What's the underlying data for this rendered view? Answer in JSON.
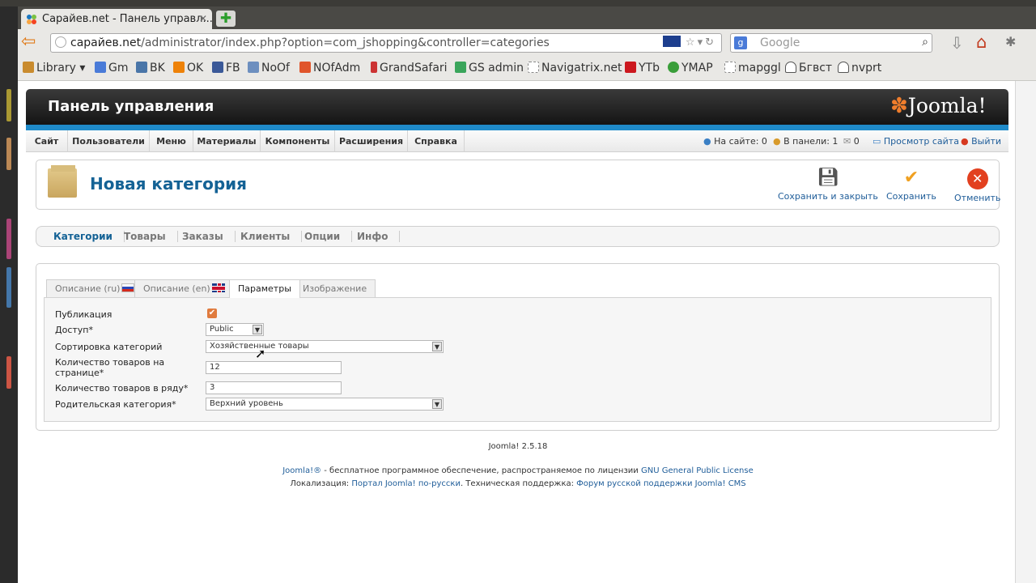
{
  "browser": {
    "tab_title": "Сарайев.net - Панель управл...",
    "url_domain": "сарайев.net",
    "url_path": "/administrator/index.php?option=com_jshopping&controller=categories",
    "search_placeholder": "Google",
    "bookmarks": [
      {
        "label": "Library",
        "color": "#c98b2e"
      },
      {
        "label": "Gm",
        "color": "#4a7bd8"
      },
      {
        "label": "BK",
        "color": "#4a76a8"
      },
      {
        "label": "OK",
        "color": "#ee8208"
      },
      {
        "label": "FB",
        "color": "#3b5998"
      },
      {
        "label": "NoOf",
        "color": "#6d8fbf"
      },
      {
        "label": "NOfAdm",
        "color": "#e0552b"
      },
      {
        "label": "GrandSafari",
        "color": "#cc3333"
      },
      {
        "label": "GS admin",
        "color": "#3aa55b"
      },
      {
        "label": "Navigatrix.net",
        "color": "#dddddd"
      },
      {
        "label": "YTb",
        "color": "#cc181e"
      },
      {
        "label": "YMAP",
        "color": "#3a9e3a"
      },
      {
        "label": "mapggl",
        "color": "#dddddd"
      },
      {
        "label": "Бгвст",
        "color": "#555555"
      },
      {
        "label": "nvprt",
        "color": "#555555"
      }
    ]
  },
  "joomla": {
    "header_title": "Панель управления",
    "logo_text": "Joomla!",
    "menu": [
      "Сайт",
      "Пользователи",
      "Меню",
      "Материалы",
      "Компоненты",
      "Расширения",
      "Справка"
    ],
    "status": {
      "online": "На сайте: 0",
      "in_panel": "В панели: 1",
      "messages": "0",
      "preview": "Просмотр сайта",
      "logout": "Выйти"
    },
    "page_title": "Новая категория",
    "toolbar": {
      "save_close": "Сохранить и закрыть",
      "save": "Сохранить",
      "cancel": "Отменить"
    },
    "subnav": [
      "Категории",
      "Товары",
      "Заказы",
      "Клиенты",
      "Опции",
      "Инфо"
    ],
    "tabs": [
      "Описание (ru)",
      "Описание (en)",
      "Параметры",
      "Изображение"
    ],
    "form": {
      "publish_label": "Публикация",
      "access_label": "Доступ*",
      "access_value": "Public",
      "sort_label": "Сортировка категорий",
      "sort_value": "Хозяйственные товары",
      "per_page_label_1": "Количество товаров на",
      "per_page_label_2": "странице*",
      "per_page_value": "12",
      "per_row_label": "Количество товаров в ряду*",
      "per_row_value": "3",
      "parent_label": "Родительская категория*",
      "parent_value": "Верхний уровень"
    },
    "version": "Joomla! 2.5.18",
    "footer": {
      "l1_link1": "Joomla!®",
      "l1_text": " - бесплатное программное обеспечение, распространяемое по лицензии ",
      "l1_link2": "GNU General Public License",
      "l2_text1": "Локализация: ",
      "l2_link1": "Портал Joomla! по-русски",
      "l2_text2": ". Техническая поддержка: ",
      "l2_link2": "Форум русской поддержки Joomla! CMS"
    }
  }
}
